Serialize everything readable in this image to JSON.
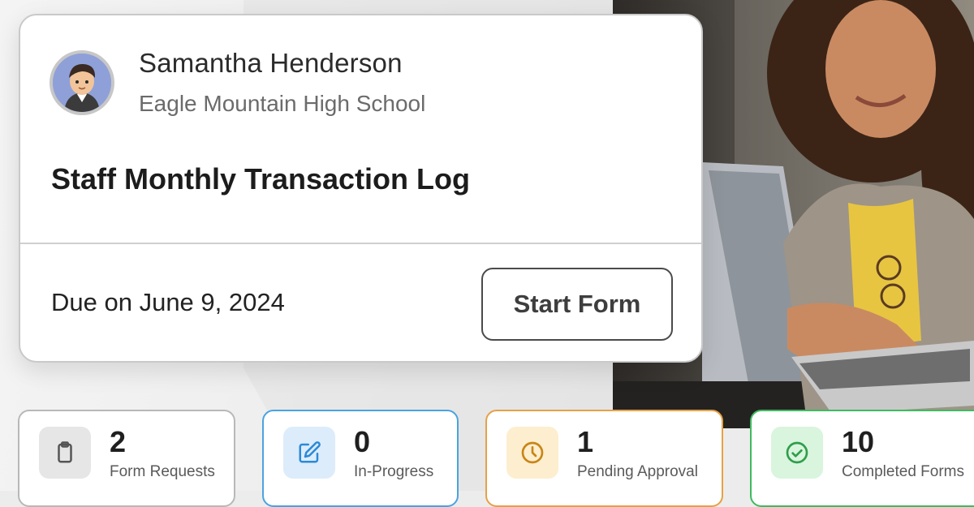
{
  "profile": {
    "name": "Samantha Henderson",
    "school": "Eagle Mountain High School"
  },
  "form": {
    "title": "Staff Monthly Transaction Log",
    "due": "Due on June 9, 2024",
    "start_label": "Start Form"
  },
  "stats": [
    {
      "value": "2",
      "label": "Form Requests",
      "icon": "clipboard-icon",
      "color": "#555555"
    },
    {
      "value": "0",
      "label": "In-Progress",
      "icon": "edit-icon",
      "color": "#2b8ad6"
    },
    {
      "value": "1",
      "label": "Pending Approval",
      "icon": "clock-icon",
      "color": "#c98516"
    },
    {
      "value": "10",
      "label": "Completed Forms",
      "icon": "check-circle-icon",
      "color": "#2e9e4c"
    }
  ]
}
